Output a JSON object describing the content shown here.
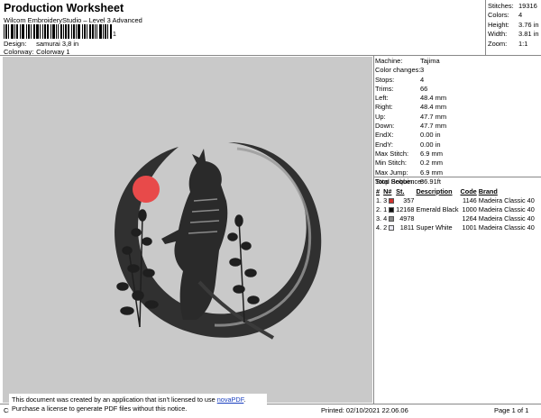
{
  "header": {
    "title": "Production Worksheet",
    "subtitle": "Wilcom EmbroideryStudio – Level 3 Advanced",
    "barcode_suffix": "1"
  },
  "design_info": [
    {
      "label": "Design:",
      "value": "samurai 3,8 in"
    },
    {
      "label": "Colorway:",
      "value": "Colorway 1"
    }
  ],
  "top_stats": [
    {
      "label": "Stitches:",
      "value": "19316"
    },
    {
      "label": "Colors:",
      "value": "4"
    },
    {
      "label": "Height:",
      "value": "3.76 in"
    },
    {
      "label": "Width:",
      "value": "3.81 in"
    },
    {
      "label": "Zoom:",
      "value": "1:1"
    }
  ],
  "machine_stats": [
    {
      "label": "Machine:",
      "value": "Tajima"
    },
    {
      "label": "Color changes:",
      "value": "3"
    },
    {
      "label": "Stops:",
      "value": "4"
    },
    {
      "label": "Trims:",
      "value": "66"
    },
    {
      "label": "Left:",
      "value": "48.4 mm"
    },
    {
      "label": "Right:",
      "value": "48.4 mm"
    },
    {
      "label": "Up:",
      "value": "47.7 mm"
    },
    {
      "label": "Down:",
      "value": "47.7 mm"
    },
    {
      "label": "EndX:",
      "value": "0.00 in"
    },
    {
      "label": "EndY:",
      "value": "0.00 in"
    },
    {
      "label": "Max Stitch:",
      "value": "6.9 mm"
    },
    {
      "label": "Min Stitch:",
      "value": "0.2 mm"
    },
    {
      "label": "Max Jump:",
      "value": "6.9 mm"
    },
    {
      "label": "Total Bobbin:",
      "value": "86.91ft"
    }
  ],
  "stop_sequence": {
    "title": "Stop Sequence:",
    "headers": {
      "stop": "#",
      "needle": "N#",
      "st": "St.",
      "description": "Description",
      "code": "Code",
      "brand": "Brand"
    },
    "rows": [
      {
        "stop": "1.",
        "needle": "3",
        "color": "#d0312d",
        "st": "357",
        "description": "",
        "code": "1146",
        "brand": "Madeira Classic 40"
      },
      {
        "stop": "2.",
        "needle": "1",
        "color": "#111111",
        "st": "12168",
        "description": "Emerald Black",
        "code": "1000",
        "brand": "Madeira Classic 40"
      },
      {
        "stop": "3.",
        "needle": "4",
        "color": "#8a8a8a",
        "st": "4978",
        "description": "",
        "code": "1264",
        "brand": "Madeira Classic 40"
      },
      {
        "stop": "4.",
        "needle": "2",
        "color": "#e8e8f2",
        "st": "1811",
        "description": "Super White",
        "code": "1001",
        "brand": "Madeira Classic 40"
      }
    ]
  },
  "notice": {
    "line1_prefix": "This document was created by an application that isn't licensed to use ",
    "link": "novaPDF",
    "line1_suffix": ".",
    "line2": "Purchase a license to generate PDF files without this notice."
  },
  "footer": {
    "left": "Cr",
    "printed": "Printed: 02/10/2021 22.06.06",
    "page": "Page 1 of 1"
  },
  "colors": {
    "design_background": "#c9c9c9",
    "sun": "#e84a4a"
  }
}
